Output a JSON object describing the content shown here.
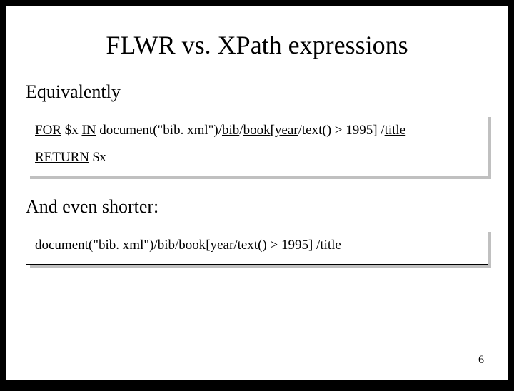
{
  "title": "FLWR vs. XPath expressions",
  "subhead1": "Equivalently",
  "subhead2": "And even shorter:",
  "code1": {
    "kw_for": "FOR",
    "var_x_1": " $x ",
    "kw_in": "IN",
    "doc_open": " document(\"bib. xml\")/",
    "seg_bib": "bib",
    "slash1": "/",
    "seg_book": "book",
    "br_open": "[",
    "seg_year": "year",
    "pred_tail": "/text() > 1995] /",
    "seg_title": "title",
    "kw_return": "RETURN",
    "var_x_2": " $x"
  },
  "code2": {
    "doc_open": "document(\"bib. xml\")/",
    "seg_bib": "bib",
    "slash1": "/",
    "seg_book": "book",
    "br_open": "[",
    "seg_year": "year",
    "pred_tail": "/text() > 1995] /",
    "seg_title": "title"
  },
  "page_number": "6"
}
